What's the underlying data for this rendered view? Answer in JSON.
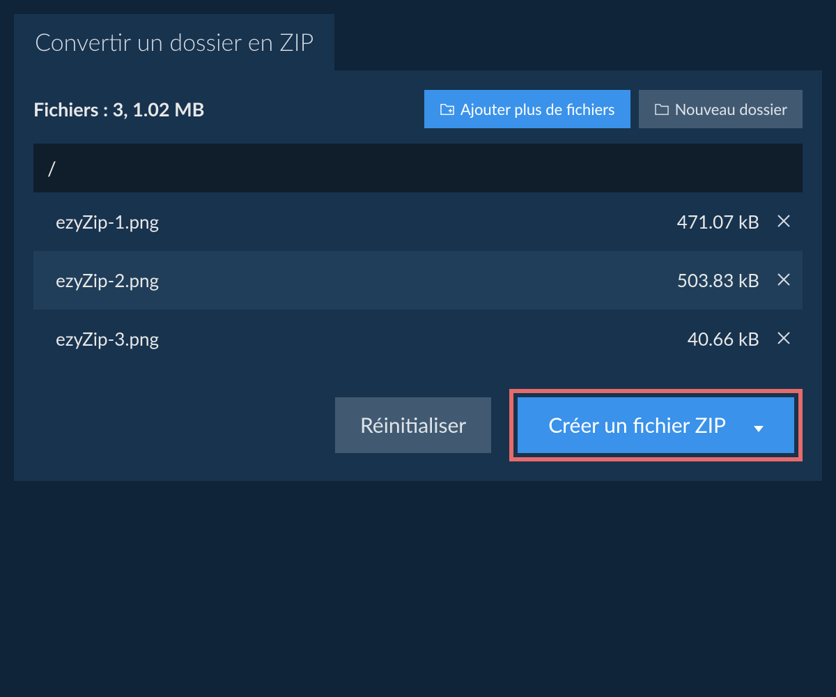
{
  "tab": {
    "title": "Convertir un dossier en ZIP"
  },
  "summary": {
    "label": "Fichiers :",
    "count": "3",
    "size": "1.02 MB"
  },
  "buttons": {
    "add_files": "Ajouter plus de fichiers",
    "new_folder": "Nouveau dossier",
    "reset": "Réinitialiser",
    "create_zip": "Créer un fichier ZIP"
  },
  "path": "/",
  "files": [
    {
      "name": "ezyZip-1.png",
      "size": "471.07 kB"
    },
    {
      "name": "ezyZip-2.png",
      "size": "503.83 kB"
    },
    {
      "name": "ezyZip-3.png",
      "size": "40.66 kB"
    }
  ],
  "colors": {
    "accent": "#3a92ea",
    "highlight_border": "#e76b6b",
    "panel": "#18334e",
    "bg": "#0f2438"
  }
}
